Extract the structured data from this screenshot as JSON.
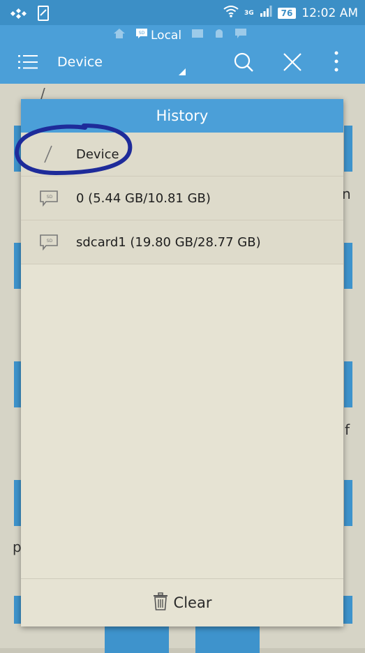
{
  "status_bar": {
    "network": "3G",
    "battery": "76",
    "time": "12:02 AM"
  },
  "app_bar": {
    "breadcrumb_local": "Local",
    "title": "Device"
  },
  "dialog": {
    "title": "History",
    "items": [
      {
        "label": "Device",
        "icon": "root-slash-icon"
      },
      {
        "label": "0 (5.44 GB/10.81 GB)",
        "icon": "sd-card-icon"
      },
      {
        "label": "sdcard1 (19.80 GB/28.77 GB)",
        "icon": "sd-card-icon"
      }
    ],
    "clear_label": "Clear"
  },
  "background": {
    "slash": "/",
    "letter_n": "n",
    "letter_f": "f",
    "letter_p": "p"
  },
  "colors": {
    "primary": "#4b9fd8",
    "status_bar": "#3c8fc6",
    "dialog_bg": "#e6e3d3",
    "annotation": "#1e2b9a"
  }
}
